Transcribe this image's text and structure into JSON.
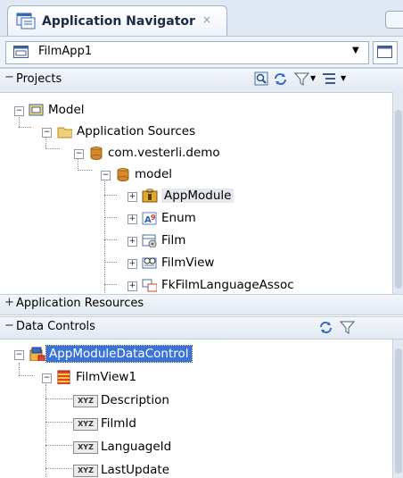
{
  "tab": {
    "title": "Application Navigator",
    "close": "×"
  },
  "app": {
    "selected": "FilmApp1"
  },
  "projects": {
    "header": "Projects",
    "tree": {
      "model_project": "Model",
      "app_sources": "Application Sources",
      "package": "com.vesterli.demo",
      "model_pkg": "model",
      "items": [
        "AppModule",
        "Enum",
        "Film",
        "FilmView",
        "FkFilmLanguageAssoc"
      ]
    }
  },
  "app_resources": {
    "header": "Application Resources"
  },
  "data_controls": {
    "header": "Data Controls",
    "root": "AppModuleDataControl",
    "view": "FilmView1",
    "attributes": [
      "Description",
      "FilmId",
      "LanguageId",
      "LastUpdate"
    ],
    "attr_badge": "XYZ"
  },
  "signs": {
    "collapse": "−",
    "expand": "+"
  },
  "colors": {
    "selection": "#3b73d6",
    "hover": "#e4e8ee",
    "header_bg": "#e2e9f2"
  }
}
